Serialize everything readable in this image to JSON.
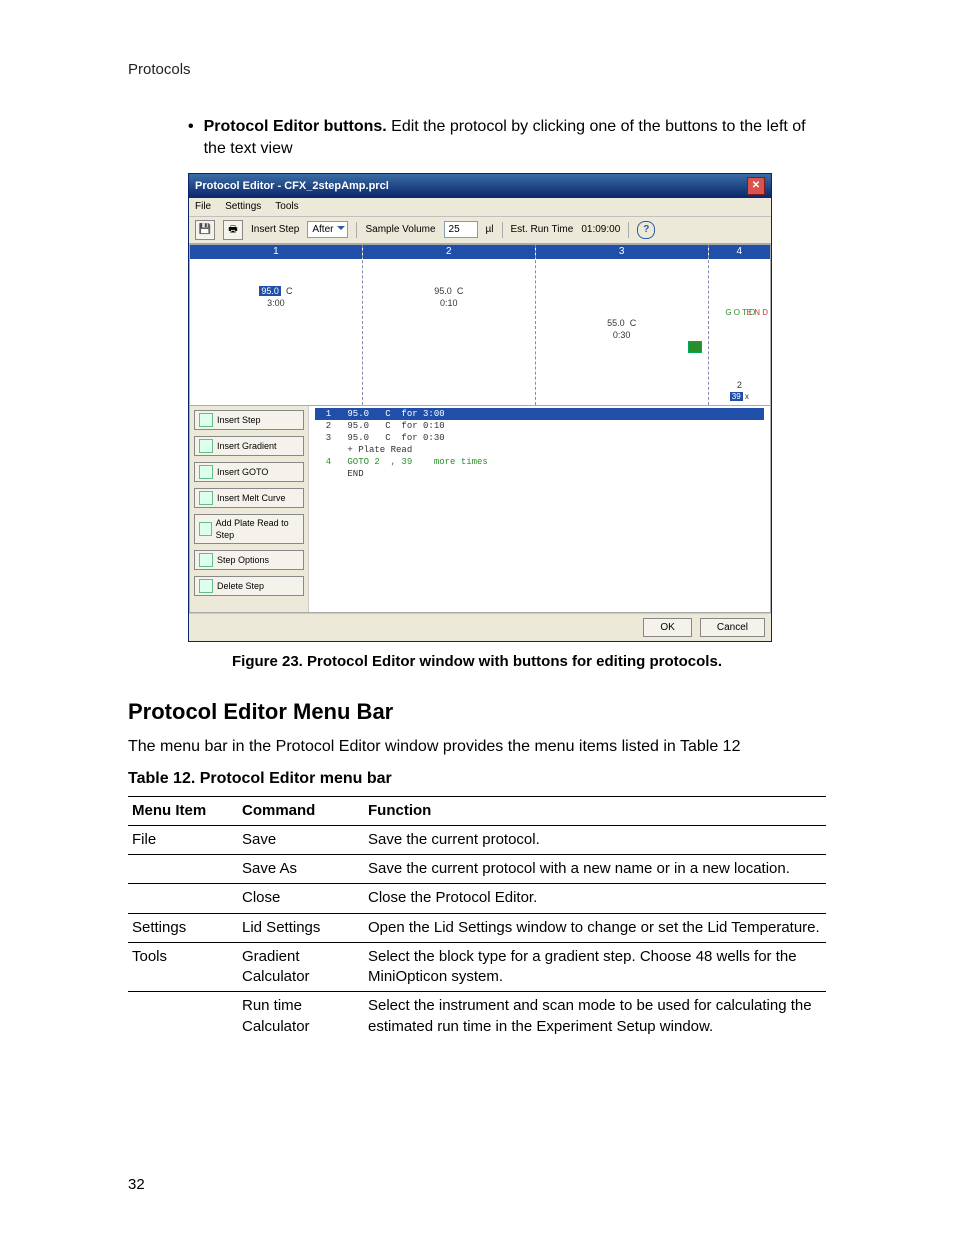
{
  "running_head": "Protocols",
  "page_number": "32",
  "bullet": {
    "lead": "Protocol Editor buttons.",
    "rest": " Edit the protocol by clicking one of the buttons to the left of the text view"
  },
  "figure": {
    "caption": "Figure 23. Protocol Editor window with buttons for editing protocols.",
    "window_title": "Protocol Editor - CFX_2stepAmp.prcl",
    "menu": {
      "file": "File",
      "settings": "Settings",
      "tools": "Tools"
    },
    "toolbar": {
      "insert_step_label": "Insert Step",
      "insert_step_value": "After",
      "sample_vol_label": "Sample Volume",
      "sample_vol_value": "25",
      "sample_vol_unit": "µl",
      "est_run_time_label": "Est. Run Time",
      "est_run_time_value": "01:09:00"
    },
    "steps": {
      "s1": {
        "num": "1",
        "temp": "95.0",
        "unit": "C",
        "time": "3:00"
      },
      "s2": {
        "num": "2",
        "temp": "95.0",
        "unit": "C",
        "time": "0:10"
      },
      "s3": {
        "num": "3",
        "temp": "55.0",
        "unit": "C",
        "time": "0:30"
      },
      "s4": {
        "num": "4",
        "goto_a": "G O T O",
        "end_a": "E N D",
        "goto_b": "2",
        "goto_c": "39",
        "goto_d": "x"
      }
    },
    "textview": {
      "r1": "  1   95.0   C  for 3:00",
      "r2": "  2   95.0   C  for 0:10",
      "r3": "  3   95.0   C  for 0:30",
      "r4": "      + Plate Read",
      "r5": "  4   GOTO 2  , 39    more times",
      "r6": "      END"
    },
    "side_buttons": {
      "insert_step": "Insert Step",
      "insert_gradient": "Insert Gradient",
      "insert_goto": "Insert GOTO",
      "insert_melt": "Insert Melt Curve",
      "add_plate_read": "Add Plate Read to Step",
      "step_options": "Step Options",
      "delete_step": "Delete Step"
    },
    "ok": "OK",
    "cancel": "Cancel"
  },
  "section_title": "Protocol Editor Menu Bar",
  "section_para": "The menu bar in the Protocol Editor window provides the menu items listed in Table 12",
  "table_title": "Table 12. Protocol Editor menu bar",
  "table": {
    "head": {
      "c1": "Menu Item",
      "c2": "Command",
      "c3": "Function"
    },
    "rows": [
      {
        "c1": "File",
        "c2": "Save",
        "c3": "Save the current protocol."
      },
      {
        "c1": "",
        "c2": "Save As",
        "c3": "Save the current protocol with a new name or in a new location."
      },
      {
        "c1": "",
        "c2": "Close",
        "c3": "Close the Protocol Editor."
      },
      {
        "c1": "Settings",
        "c2": "Lid Settings",
        "c3": "Open the Lid Settings window to change or set the Lid Temperature."
      },
      {
        "c1": "Tools",
        "c2": "Gradient Calculator",
        "c3": "Select the block type for a gradient step. Choose 48 wells for the MiniOpticon system."
      },
      {
        "c1": "",
        "c2": "Run time Calculator",
        "c3": "Select the instrument and scan mode to be used for calculating the estimated run time in the Experiment Setup window."
      }
    ]
  }
}
